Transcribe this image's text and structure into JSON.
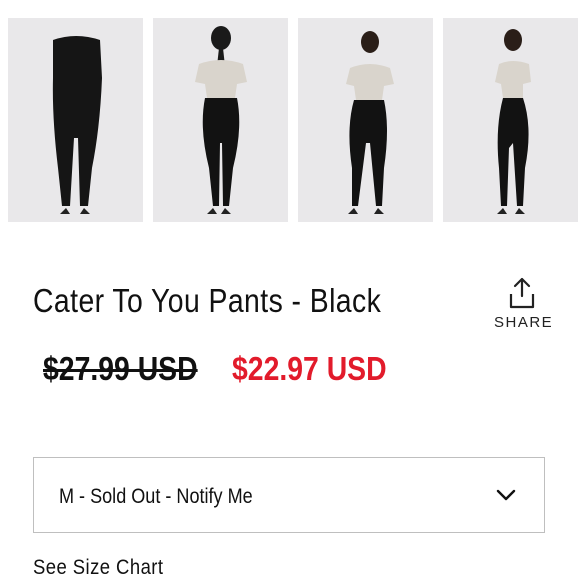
{
  "gallery": {
    "images": [
      {
        "alt": "front view",
        "icon": "product-photo"
      },
      {
        "alt": "back view",
        "icon": "product-photo"
      },
      {
        "alt": "three-quarter view",
        "icon": "product-photo"
      },
      {
        "alt": "side view",
        "icon": "product-photo"
      }
    ]
  },
  "product": {
    "title": "Cater To You Pants - Black",
    "original_price": "$27.99 USD",
    "sale_price": "$22.97 USD"
  },
  "share": {
    "label": "SHARE",
    "icon": "share-icon"
  },
  "size_select": {
    "selected": "M - Sold Out - Notify Me",
    "icon": "chevron-down-icon"
  },
  "size_chart_link": "See Size Chart",
  "colors": {
    "sale_price": "#e21b2b",
    "thumb_bg": "#e9e8ea",
    "border": "#bfbfbf"
  }
}
